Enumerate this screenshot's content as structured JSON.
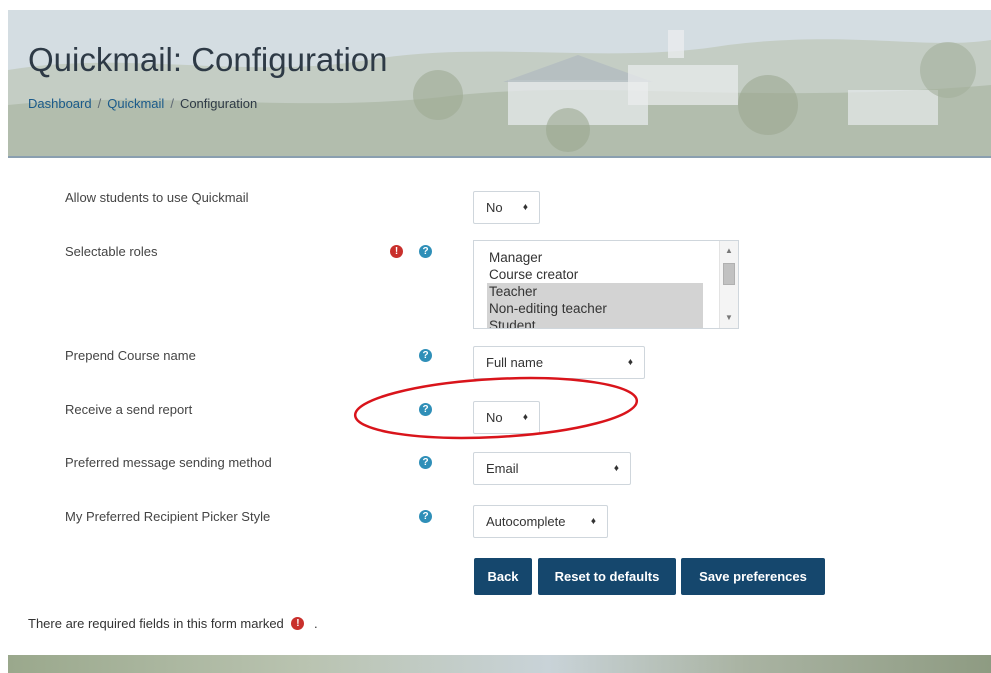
{
  "header": {
    "title": "Quickmail: Configuration",
    "breadcrumb": [
      "Dashboard",
      "Quickmail",
      "Configuration"
    ],
    "breadcrumb_separator": "/"
  },
  "form": {
    "allow_students": {
      "label": "Allow students to use Quickmail",
      "value": "No"
    },
    "selectable_roles": {
      "label": "Selectable roles",
      "options": [
        "Manager",
        "Course creator",
        "Teacher",
        "Non-editing teacher",
        "Student"
      ],
      "selected": [
        "Teacher",
        "Non-editing teacher",
        "Student"
      ]
    },
    "prepend_course_name": {
      "label": "Prepend Course name",
      "value": "Full name"
    },
    "receive_send_report": {
      "label": "Receive a send report",
      "value": "No"
    },
    "preferred_sending_method": {
      "label": "Preferred message sending method",
      "value": "Email"
    },
    "recipient_picker_style": {
      "label": "My Preferred Recipient Picker Style",
      "value": "Autocomplete"
    }
  },
  "buttons": {
    "back": "Back",
    "reset": "Reset to defaults",
    "save": "Save preferences"
  },
  "footer_note": {
    "text": "There are required fields in this form marked",
    "trailing": "."
  },
  "icons": {
    "help": "?",
    "required": "!",
    "caret": "♦"
  },
  "colors": {
    "button_bg": "#15476d",
    "help_icon": "#2f8fb8",
    "required_icon": "#c9302c",
    "highlight": "#d9141b"
  }
}
